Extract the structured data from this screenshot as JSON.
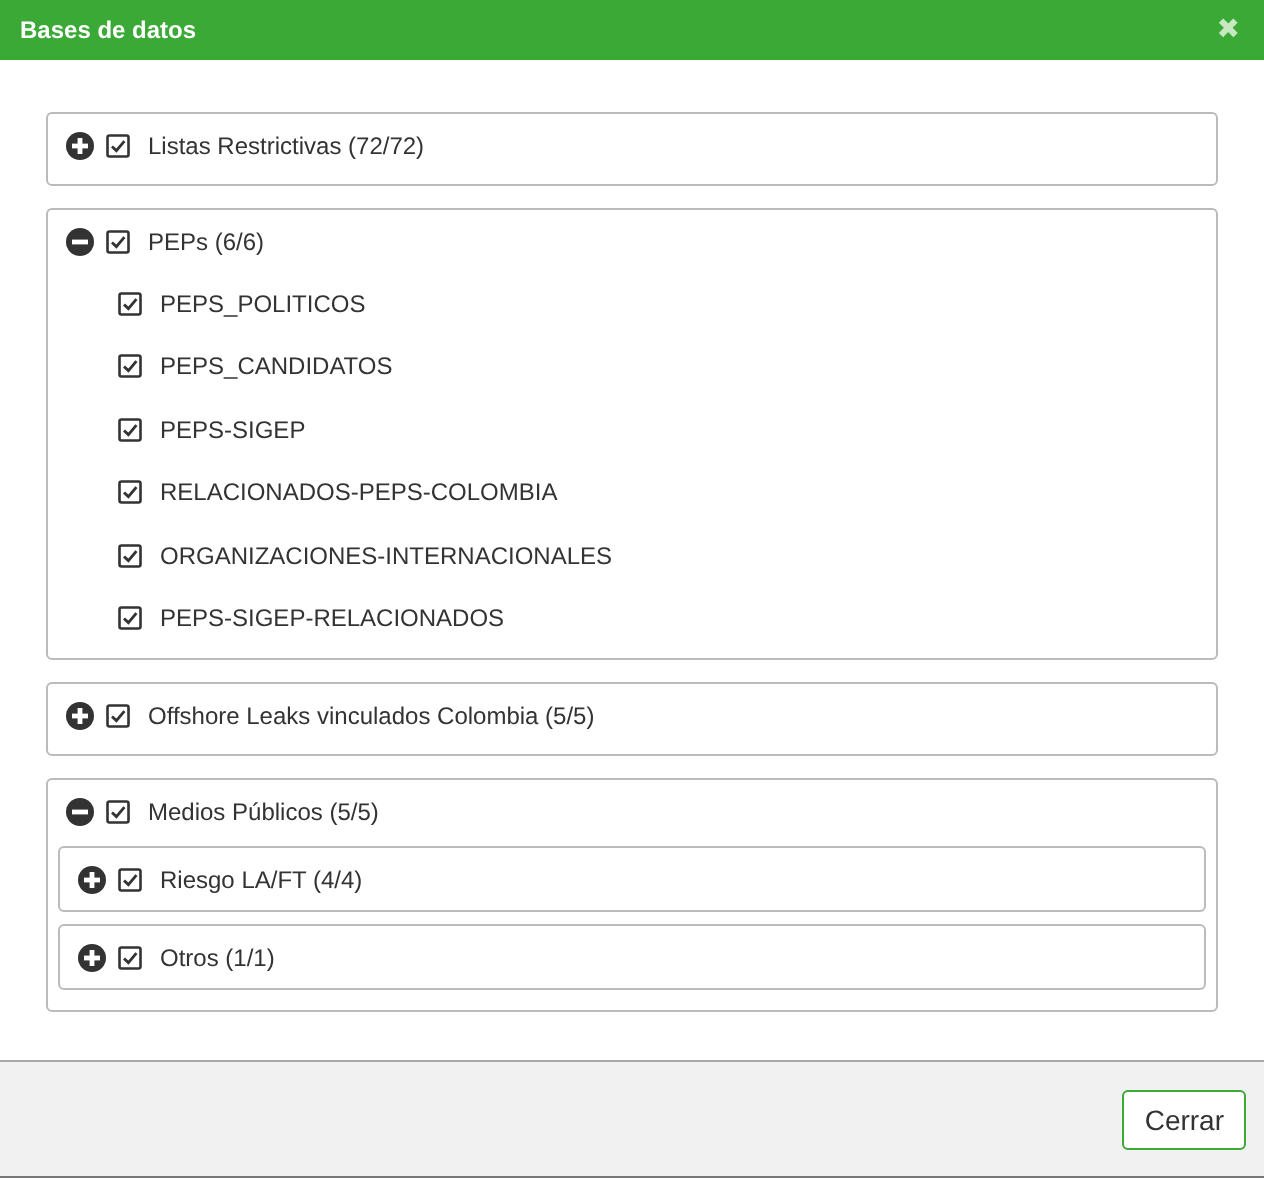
{
  "dialog": {
    "title": "Bases de datos",
    "close": "✖"
  },
  "groups": [
    {
      "kind": "group",
      "label": "Listas Restrictivas (72/72)",
      "expanded": false,
      "checked": true
    },
    {
      "kind": "group",
      "label": "PEPs (6/6)",
      "expanded": true,
      "checked": true,
      "children": [
        {
          "kind": "item",
          "label": "PEPS_POLITICOS",
          "checked": true
        },
        {
          "kind": "item",
          "label": "PEPS_CANDIDATOS",
          "checked": true
        },
        {
          "kind": "item",
          "label": "PEPS-SIGEP",
          "checked": true
        },
        {
          "kind": "item",
          "label": "RELACIONADOS-PEPS-COLOMBIA",
          "checked": true
        },
        {
          "kind": "item",
          "label": "ORGANIZACIONES-INTERNACIONALES",
          "checked": true
        },
        {
          "kind": "item",
          "label": "PEPS-SIGEP-RELACIONADOS",
          "checked": true
        }
      ]
    },
    {
      "kind": "group",
      "label": "Offshore Leaks vinculados Colombia (5/5)",
      "expanded": false,
      "checked": true
    },
    {
      "kind": "group",
      "label": "Medios Públicos (5/5)",
      "expanded": true,
      "checked": true,
      "children": [
        {
          "kind": "group",
          "label": "Riesgo LA/FT (4/4)",
          "expanded": false,
          "checked": true
        },
        {
          "kind": "group",
          "label": "Otros (1/1)",
          "expanded": false,
          "checked": true
        }
      ]
    }
  ],
  "footer": {
    "button": "Cerrar"
  }
}
